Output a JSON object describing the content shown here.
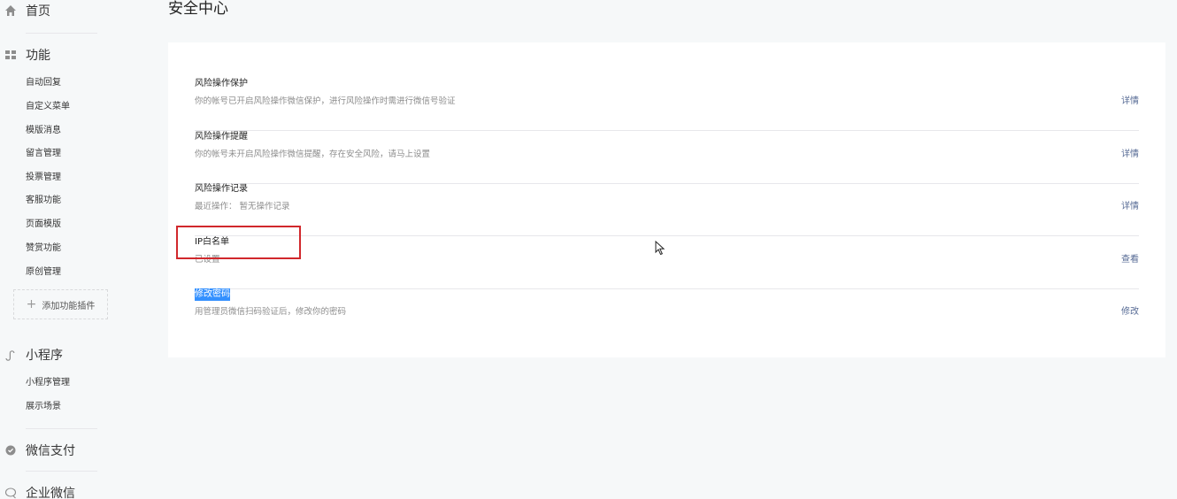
{
  "sidebar": {
    "home": "首页",
    "features": {
      "label": "功能",
      "items": [
        "自动回复",
        "自定义菜单",
        "模版消息",
        "留言管理",
        "投票管理",
        "客服功能",
        "页面模版",
        "赞赏功能",
        "原创管理"
      ],
      "add_plugin": "添加功能插件"
    },
    "miniprogram": {
      "label": "小程序",
      "items": [
        "小程序管理",
        "展示场景"
      ]
    },
    "wechat_pay": "微信支付",
    "work_wechat": "企业微信"
  },
  "main": {
    "title": "安全中心",
    "rows": [
      {
        "title": "风险操作保护",
        "desc": "你的帐号已开启风险操作微信保护，进行风险操作时需进行微信号验证",
        "action": "详情"
      },
      {
        "title": "风险操作提醒",
        "desc": "你的帐号未开启风险操作微信提醒，存在安全风险，请马上设置",
        "action": "详情"
      },
      {
        "title": "风险操作记录",
        "desc": "最近操作：  暂无操作记录",
        "action": "详情"
      },
      {
        "title": "IP白名单",
        "desc": "已设置",
        "action": "查看"
      },
      {
        "title": "修改密码",
        "desc": "用管理员微信扫码验证后，修改你的密码",
        "action": "修改"
      }
    ]
  },
  "colors": {
    "link": "#576b95",
    "highlight": "#d1282c",
    "selection": "#3390ff"
  }
}
